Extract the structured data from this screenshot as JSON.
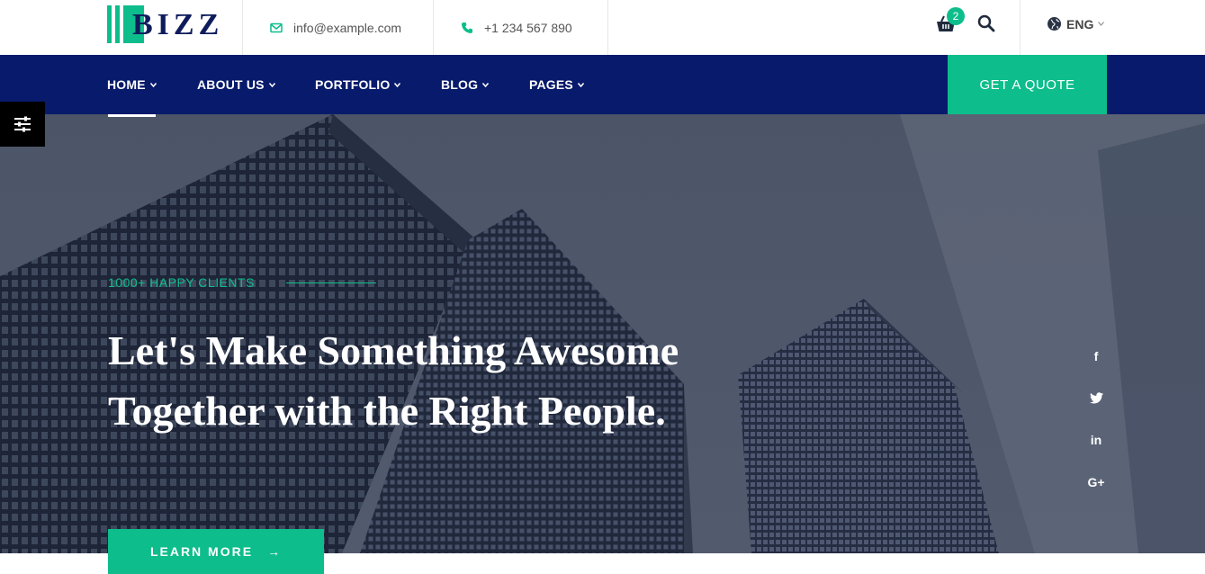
{
  "brand": {
    "name": "BIZZ"
  },
  "contact": {
    "email": "info@example.com",
    "phone": "+1 234 567 890"
  },
  "cart": {
    "count": "2"
  },
  "language": {
    "label": "ENG"
  },
  "nav": {
    "items": [
      {
        "label": "HOME"
      },
      {
        "label": "ABOUT US"
      },
      {
        "label": "PORTFOLIO"
      },
      {
        "label": "BLOG"
      },
      {
        "label": "PAGES"
      }
    ],
    "cta": "GET A QUOTE"
  },
  "hero": {
    "eyebrow": "1000+ HAPPY CLIENTS",
    "headline": "Let's Make Something Awesome Together with the Right People.",
    "button": "LEARN MORE"
  },
  "social": {
    "facebook": "f",
    "twitter": "twitter-icon",
    "linkedin": "in",
    "googleplus": "G+"
  },
  "colors": {
    "accent": "#0dbd8b",
    "navy": "#071a6b",
    "hero_overlay": "#5b6478"
  }
}
